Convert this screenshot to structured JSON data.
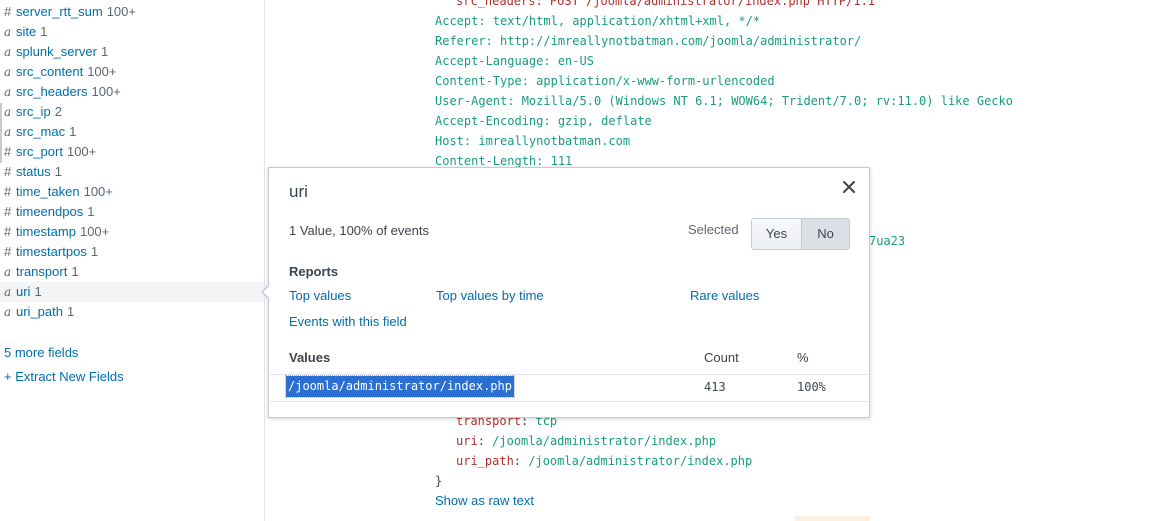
{
  "sidebar": {
    "fields": [
      {
        "type": "#",
        "name": "server_rtt_sum",
        "count": "100+"
      },
      {
        "type": "a",
        "name": "site",
        "count": "1"
      },
      {
        "type": "a",
        "name": "splunk_server",
        "count": "1"
      },
      {
        "type": "a",
        "name": "src_content",
        "count": "100+"
      },
      {
        "type": "a",
        "name": "src_headers",
        "count": "100+"
      },
      {
        "type": "a",
        "name": "src_ip",
        "count": "2"
      },
      {
        "type": "a",
        "name": "src_mac",
        "count": "1"
      },
      {
        "type": "#",
        "name": "src_port",
        "count": "100+"
      },
      {
        "type": "#",
        "name": "status",
        "count": "1"
      },
      {
        "type": "#",
        "name": "time_taken",
        "count": "100+"
      },
      {
        "type": "#",
        "name": "timeendpos",
        "count": "1"
      },
      {
        "type": "#",
        "name": "timestamp",
        "count": "100+"
      },
      {
        "type": "#",
        "name": "timestartpos",
        "count": "1"
      },
      {
        "type": "a",
        "name": "transport",
        "count": "1"
      },
      {
        "type": "a",
        "name": "uri",
        "count": "1"
      },
      {
        "type": "a",
        "name": "uri_path",
        "count": "1"
      }
    ],
    "more_fields": "5 more fields",
    "extract_new_fields": "+ Extract New Fields"
  },
  "event": {
    "header_lines": [
      "src_headers: POST /joomla/administrator/index.php HTTP/1.1",
      "Accept: text/html, application/xhtml+xml, */*",
      "Referer: http://imreallynotbatman.com/joomla/administrator/",
      "Accept-Language: en-US",
      "Content-Type: application/x-www-form-urlencoded",
      "User-Agent: Mozilla/5.0 (Windows NT 6.1; WOW64; Trident/7.0; rv:11.0) like Gecko",
      "Accept-Encoding: gzip, deflate",
      "Host: imreallynotbatman.com",
      "Content-Length: 111"
    ],
    "partial_visible_text": "7ua23",
    "kv": [
      {
        "key": "transport",
        "value": "tcp"
      },
      {
        "key": "uri",
        "value": "/joomla/administrator/index.php"
      },
      {
        "key": "uri_path",
        "value": "/joomla/administrator/index.php"
      }
    ],
    "closing_brace": "}",
    "show_raw": "Show as raw text"
  },
  "popover": {
    "title": "uri",
    "close_glyph": "✕",
    "summary": "1 Value, 100% of events",
    "selected_label": "Selected",
    "yes": "Yes",
    "no": "No",
    "reports_heading": "Reports",
    "links": {
      "top_values": "Top values",
      "top_values_by_time": "Top values by time",
      "rare_values": "Rare values",
      "events_with_field": "Events with this field"
    },
    "table": {
      "values_header": "Values",
      "count_header": "Count",
      "percent_header": "%",
      "rows": [
        {
          "value": "/joomla/administrator/index.php",
          "count": "413",
          "percent": "100%"
        }
      ]
    }
  },
  "colors": {
    "link": "#006eaa",
    "code_value": "#1a9c7e",
    "code_key": "#b0302e",
    "selection": "#2a6fd1"
  }
}
